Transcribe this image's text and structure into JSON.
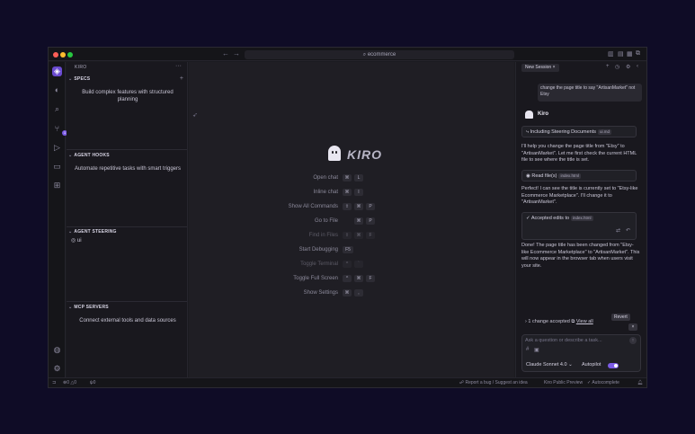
{
  "titlebar": {
    "search_text": "ecommerce",
    "search_icon": "search-icon"
  },
  "sidebar": {
    "title": "KIRO",
    "sections": {
      "specs": {
        "header": "SPECS",
        "body": "Build complex features with structured planning"
      },
      "hooks": {
        "header": "AGENT HOOKS",
        "body": "Automate repetitive tasks with smart triggers"
      },
      "steering": {
        "header": "AGENT STEERING",
        "item": "ui"
      },
      "mcp": {
        "header": "MCP SERVERS",
        "body": "Connect external tools and data sources"
      }
    }
  },
  "editor": {
    "logo_text": "KIRO",
    "shortcuts": [
      {
        "label": "Open chat",
        "keys": [
          "⌘",
          "L"
        ]
      },
      {
        "label": "Inline chat",
        "keys": [
          "⌘",
          "I"
        ]
      },
      {
        "label": "Show All Commands",
        "keys": [
          "⇧",
          "⌘",
          "P"
        ]
      },
      {
        "label": "Go to File",
        "keys": [
          "⌘",
          "P"
        ]
      },
      {
        "label": "Find in Files",
        "keys": [
          "⇧",
          "⌘",
          "F"
        ]
      },
      {
        "label": "Start Debugging",
        "keys": [
          "F5"
        ]
      },
      {
        "label": "Toggle Terminal",
        "keys": [
          "^",
          "`"
        ]
      },
      {
        "label": "Toggle Full Screen",
        "keys": [
          "^",
          "⌘",
          "F"
        ]
      },
      {
        "label": "Show Settings",
        "keys": [
          "⌘",
          ","
        ]
      }
    ]
  },
  "chat": {
    "session_tab": "New Session",
    "user_message": "change the page title to say \"ArtisanMarket\" not Etsy",
    "agent_name": "Kiro",
    "steering_label": "Including Steering Documents",
    "steering_pill": "ui.md",
    "msg1": "I'll help you change the page title from \"Etsy\" to \"ArtisanMarket\". Let me first check the current HTML file to see where the title is set.",
    "read_label": "Read file(s)",
    "read_pill": "index.html",
    "msg2": "Perfect! I can see the title is currently set to \"Etsy-like Ecommerce Marketplace\". I'll change it to \"ArtisanMarket\".",
    "accepted_label": "Accepted edits to",
    "accepted_pill": "index.html",
    "msg3": "Done! The page title has been changed from \"Etsy-like Ecommerce Marketplace\" to \"ArtisanMarket\". This will now appear in the browser tab when users visit your site.",
    "change_status": "1 change accepted",
    "view_all": "View all",
    "revert": "Revert",
    "input_placeholder": "Ask a question or describe a task...",
    "model": "Claude Sonnet 4.0",
    "autopilot": "Autopilot",
    "accent": "#7c5ce6"
  },
  "statusbar": {
    "errors": "0",
    "warnings": "0",
    "ports": "0",
    "report": "Report a bug / Suggest an idea",
    "preview": "Kiro Public Preview",
    "autocomplete": "Autocomplete"
  }
}
